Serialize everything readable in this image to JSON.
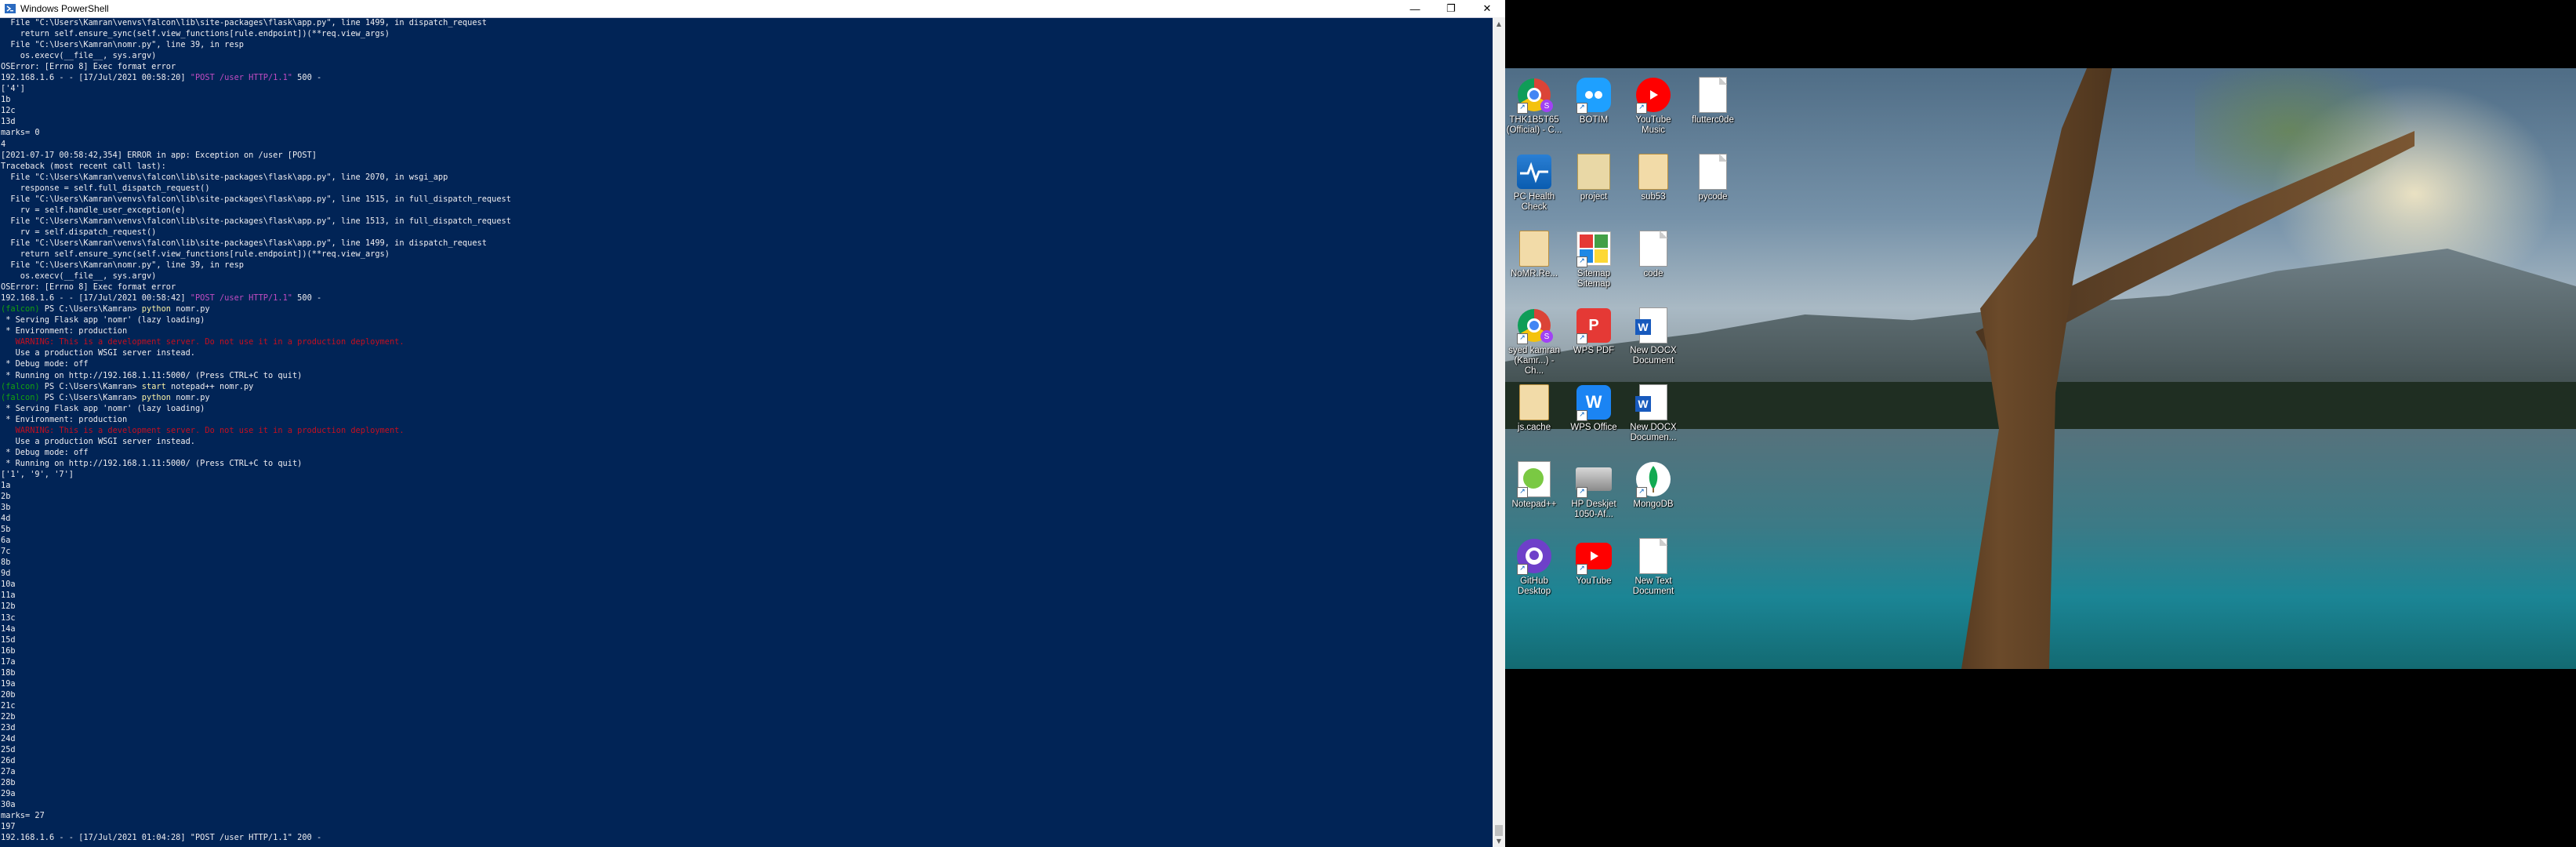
{
  "window": {
    "title": "Windows PowerShell",
    "minimize_glyph": "—",
    "restore_glyph": "❐",
    "close_glyph": "✕"
  },
  "console_lines": [
    {
      "t": "  File \"C:\\Users\\Kamran\\venvs\\falcon\\lib\\site-packages\\flask\\app.py\", line 1499, in dispatch_request",
      "c": ""
    },
    {
      "t": "    return self.ensure_sync(self.view_functions[rule.endpoint])(**req.view_args)",
      "c": ""
    },
    {
      "t": "  File \"C:\\Users\\Kamran\\nomr.py\", line 39, in resp",
      "c": ""
    },
    {
      "t": "    os.execv(__file__, sys.argv)",
      "c": ""
    },
    {
      "t": "OSError: [Errno 8] Exec format error",
      "c": ""
    },
    {
      "t": "192.168.1.6 - - [17/Jul/2021 00:58:20] \"POST /user HTTP/1.1\" 500 -",
      "c": "",
      "seg": [
        {
          "s": "192.168.1.6 - - [17/Jul/2021 00:58:20] ",
          "c": ""
        },
        {
          "s": "\"POST /user HTTP/1.1\"",
          "c": "c-magenta"
        },
        {
          "s": " 500 -",
          "c": ""
        }
      ]
    },
    {
      "t": "['4']",
      "c": ""
    },
    {
      "t": "1b",
      "c": ""
    },
    {
      "t": "12c",
      "c": ""
    },
    {
      "t": "13d",
      "c": ""
    },
    {
      "t": "marks= 0",
      "c": ""
    },
    {
      "t": "4",
      "c": ""
    },
    {
      "t": "[2021-07-17 00:58:42,354] ERROR in app: Exception on /user [POST]",
      "c": ""
    },
    {
      "t": "Traceback (most recent call last):",
      "c": ""
    },
    {
      "t": "  File \"C:\\Users\\Kamran\\venvs\\falcon\\lib\\site-packages\\flask\\app.py\", line 2070, in wsgi_app",
      "c": ""
    },
    {
      "t": "    response = self.full_dispatch_request()",
      "c": ""
    },
    {
      "t": "  File \"C:\\Users\\Kamran\\venvs\\falcon\\lib\\site-packages\\flask\\app.py\", line 1515, in full_dispatch_request",
      "c": ""
    },
    {
      "t": "    rv = self.handle_user_exception(e)",
      "c": ""
    },
    {
      "t": "  File \"C:\\Users\\Kamran\\venvs\\falcon\\lib\\site-packages\\flask\\app.py\", line 1513, in full_dispatch_request",
      "c": ""
    },
    {
      "t": "    rv = self.dispatch_request()",
      "c": ""
    },
    {
      "t": "  File \"C:\\Users\\Kamran\\venvs\\falcon\\lib\\site-packages\\flask\\app.py\", line 1499, in dispatch_request",
      "c": ""
    },
    {
      "t": "    return self.ensure_sync(self.view_functions[rule.endpoint])(**req.view_args)",
      "c": ""
    },
    {
      "t": "  File \"C:\\Users\\Kamran\\nomr.py\", line 39, in resp",
      "c": ""
    },
    {
      "t": "    os.execv(__file__, sys.argv)",
      "c": ""
    },
    {
      "t": "OSError: [Errno 8] Exec format error",
      "c": ""
    },
    {
      "t": "192.168.1.6 - - [17/Jul/2021 00:58:42] \"POST /user HTTP/1.1\" 500 -",
      "c": "",
      "seg": [
        {
          "s": "192.168.1.6 - - [17/Jul/2021 00:58:42] ",
          "c": ""
        },
        {
          "s": "\"POST /user HTTP/1.1\"",
          "c": "c-magenta"
        },
        {
          "s": " 500 -",
          "c": ""
        }
      ]
    },
    {
      "t": "(falcon) PS C:\\Users\\Kamran> python nomr.py",
      "c": "",
      "seg": [
        {
          "s": "(falcon)",
          "c": "c-green"
        },
        {
          "s": " PS C:\\Users\\Kamran> ",
          "c": ""
        },
        {
          "s": "python",
          "c": "c-yellow"
        },
        {
          "s": " nomr.py",
          "c": ""
        }
      ]
    },
    {
      "t": " * Serving Flask app 'nomr' (lazy loading)",
      "c": ""
    },
    {
      "t": " * Environment: production",
      "c": ""
    },
    {
      "t": "   WARNING: This is a development server. Do not use it in a production deployment.",
      "c": "c-red"
    },
    {
      "t": "   Use a production WSGI server instead.",
      "c": ""
    },
    {
      "t": " * Debug mode: off",
      "c": ""
    },
    {
      "t": " * Running on http://192.168.1.11:5000/ (Press CTRL+C to quit)",
      "c": ""
    },
    {
      "t": "(falcon) PS C:\\Users\\Kamran> start notepad++ nomr.py",
      "c": "",
      "seg": [
        {
          "s": "(falcon)",
          "c": "c-green"
        },
        {
          "s": " PS C:\\Users\\Kamran> ",
          "c": ""
        },
        {
          "s": "start",
          "c": "c-yellow"
        },
        {
          "s": " notepad++ nomr.py",
          "c": ""
        }
      ]
    },
    {
      "t": "(falcon) PS C:\\Users\\Kamran> python nomr.py",
      "c": "",
      "seg": [
        {
          "s": "(falcon)",
          "c": "c-green"
        },
        {
          "s": " PS C:\\Users\\Kamran> ",
          "c": ""
        },
        {
          "s": "python",
          "c": "c-yellow"
        },
        {
          "s": " nomr.py",
          "c": ""
        }
      ]
    },
    {
      "t": " * Serving Flask app 'nomr' (lazy loading)",
      "c": ""
    },
    {
      "t": " * Environment: production",
      "c": ""
    },
    {
      "t": "   WARNING: This is a development server. Do not use it in a production deployment.",
      "c": "c-red"
    },
    {
      "t": "   Use a production WSGI server instead.",
      "c": ""
    },
    {
      "t": " * Debug mode: off",
      "c": ""
    },
    {
      "t": " * Running on http://192.168.1.11:5000/ (Press CTRL+C to quit)",
      "c": ""
    },
    {
      "t": "['1', '9', '7']",
      "c": ""
    },
    {
      "t": "1a",
      "c": ""
    },
    {
      "t": "2b",
      "c": ""
    },
    {
      "t": "3b",
      "c": ""
    },
    {
      "t": "4d",
      "c": ""
    },
    {
      "t": "5b",
      "c": ""
    },
    {
      "t": "6a",
      "c": ""
    },
    {
      "t": "7c",
      "c": ""
    },
    {
      "t": "8b",
      "c": ""
    },
    {
      "t": "9d",
      "c": ""
    },
    {
      "t": "10a",
      "c": ""
    },
    {
      "t": "11a",
      "c": ""
    },
    {
      "t": "12b",
      "c": ""
    },
    {
      "t": "13c",
      "c": ""
    },
    {
      "t": "14a",
      "c": ""
    },
    {
      "t": "15d",
      "c": ""
    },
    {
      "t": "16b",
      "c": ""
    },
    {
      "t": "17a",
      "c": ""
    },
    {
      "t": "18b",
      "c": ""
    },
    {
      "t": "19a",
      "c": ""
    },
    {
      "t": "20b",
      "c": ""
    },
    {
      "t": "21c",
      "c": ""
    },
    {
      "t": "22b",
      "c": ""
    },
    {
      "t": "23d",
      "c": ""
    },
    {
      "t": "24d",
      "c": ""
    },
    {
      "t": "25d",
      "c": ""
    },
    {
      "t": "26d",
      "c": ""
    },
    {
      "t": "27a",
      "c": ""
    },
    {
      "t": "28b",
      "c": ""
    },
    {
      "t": "29a",
      "c": ""
    },
    {
      "t": "30a",
      "c": ""
    },
    {
      "t": "marks= 27",
      "c": ""
    },
    {
      "t": "197",
      "c": ""
    },
    {
      "t": "192.168.1.6 - - [17/Jul/2021 01:04:28] \"POST /user HTTP/1.1\" 200 -",
      "c": ""
    }
  ],
  "scrollbar": {
    "up": "▲",
    "down": "▼"
  },
  "desktop_icons": [
    {
      "name": "chrome-profile-icon",
      "label": "THK1B5T65 (Official) - C...",
      "kind": "chrome",
      "shortcut": true
    },
    {
      "name": "botim-icon",
      "label": "BOTIM",
      "kind": "botim",
      "shortcut": true
    },
    {
      "name": "youtube-music-icon",
      "label": "YouTube Music",
      "kind": "ytm",
      "shortcut": true
    },
    {
      "name": "file-icon",
      "label": "flutterc0de",
      "kind": "doc",
      "shortcut": false
    },
    {
      "name": "pc-health-check-icon",
      "label": "PC Health Check",
      "kind": "health",
      "shortcut": false
    },
    {
      "name": "folder-icon",
      "label": "project",
      "kind": "folder",
      "shortcut": false
    },
    {
      "name": "sublime-file-icon",
      "label": "sub53",
      "kind": "sublime",
      "shortcut": false
    },
    {
      "name": "file-icon",
      "label": "pycode",
      "kind": "doc",
      "shortcut": false
    },
    {
      "name": "archive-icon",
      "label": "NoMR.Re...",
      "kind": "sublime",
      "shortcut": false
    },
    {
      "name": "sitemap-icon",
      "label": "Sitemap Sitemap",
      "kind": "sitemap",
      "shortcut": true
    },
    {
      "name": "file-icon",
      "label": "code",
      "kind": "doc",
      "shortcut": false
    },
    {
      "name": "chrome-profile-icon",
      "label": "syed kamran (Kamr...) - Ch...",
      "kind": "chrome",
      "shortcut": true
    },
    {
      "name": "wps-pdf-icon",
      "label": "WPS PDF",
      "kind": "wpspdf",
      "shortcut": true
    },
    {
      "name": "word-document-icon",
      "label": "New DOCX Document",
      "kind": "word",
      "shortcut": false
    },
    {
      "name": "archive-icon",
      "label": "js.cache",
      "kind": "sublime",
      "shortcut": false
    },
    {
      "name": "wps-office-icon",
      "label": "WPS Office",
      "kind": "wpsoffice",
      "shortcut": true
    },
    {
      "name": "word-document-icon",
      "label": "New DOCX Documen...",
      "kind": "word",
      "shortcut": false
    },
    {
      "name": "notepadpp-icon",
      "label": "Notepad++",
      "kind": "npp",
      "shortcut": true
    },
    {
      "name": "printer-icon",
      "label": "HP Deskjet 1050-Af...",
      "kind": "printer",
      "shortcut": true
    },
    {
      "name": "mongodb-icon",
      "label": "MongoDB",
      "kind": "mongo",
      "shortcut": true
    },
    {
      "name": "github-desktop-icon",
      "label": "GitHub Desktop",
      "kind": "github",
      "shortcut": true
    },
    {
      "name": "youtube-icon",
      "label": "YouTube",
      "kind": "yt",
      "shortcut": true
    },
    {
      "name": "text-document-icon",
      "label": "New Text Document",
      "kind": "doc",
      "shortcut": false
    }
  ],
  "colors": {
    "console_bg": "#012456",
    "console_fg": "#eeedf0",
    "prompt_green": "#13a10e",
    "command_yellow": "#f9f1a5",
    "warning_red": "#c50f1f",
    "string_magenta": "#c14cc1"
  }
}
